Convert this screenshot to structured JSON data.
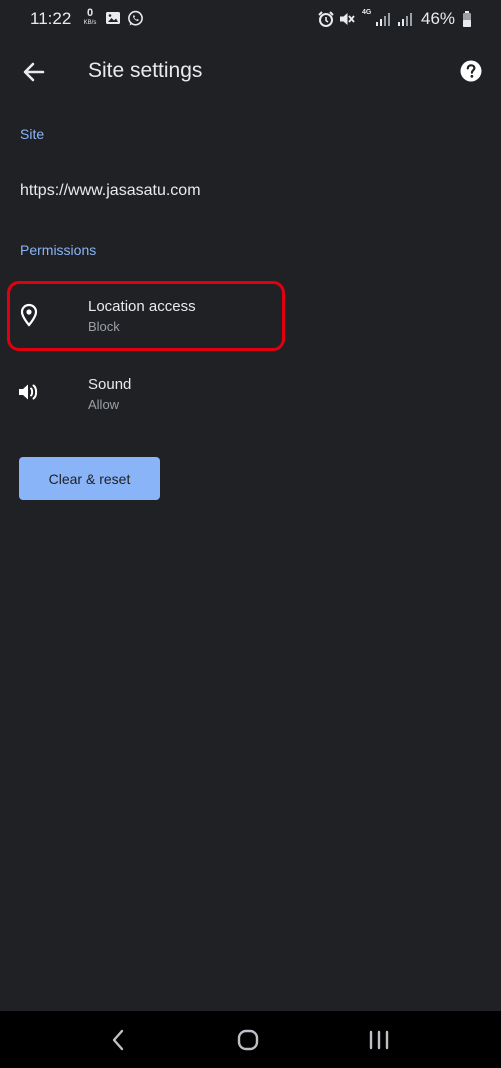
{
  "status_bar": {
    "time": "11:22",
    "data_rate_value": "0",
    "data_rate_unit": "KB/s",
    "network_type": "4G",
    "battery": "46%",
    "icons": [
      "gallery-icon",
      "whatsapp-icon",
      "alarm-icon",
      "mute-icon",
      "signal-icon",
      "signal-icon",
      "battery-icon"
    ]
  },
  "toolbar": {
    "title": "Site settings",
    "back_icon": "arrow-left-icon",
    "help_icon": "help-circle-icon"
  },
  "site_section": {
    "header": "Site",
    "url": "https://www.jasasatu.com"
  },
  "permissions_section": {
    "header": "Permissions",
    "items": [
      {
        "label": "Location access",
        "value": "Block",
        "icon": "location-pin-icon",
        "highlighted": true
      },
      {
        "label": "Sound",
        "value": "Allow",
        "icon": "speaker-icon",
        "highlighted": false
      }
    ]
  },
  "clear_button": {
    "label": "Clear & reset"
  },
  "nav_bar": {
    "icons": [
      "back-chevron-icon",
      "home-icon",
      "recent-apps-icon"
    ]
  },
  "colors": {
    "background": "#202124",
    "accent": "#8ab4f8",
    "highlight": "#e1000f",
    "text_primary": "#e8eaed",
    "text_secondary": "#9aa0a6"
  }
}
